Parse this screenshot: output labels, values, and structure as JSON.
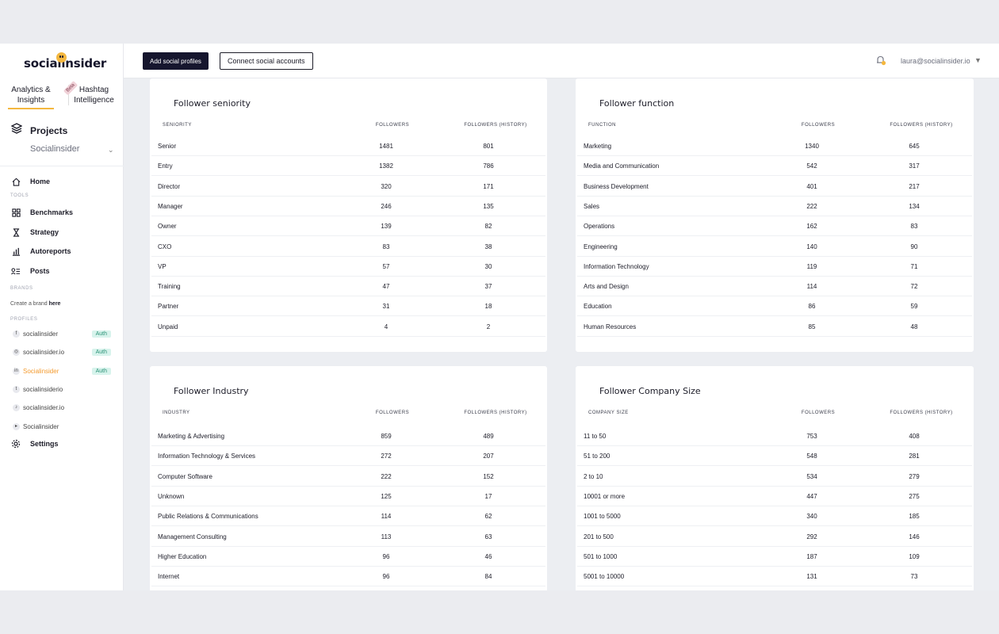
{
  "brand": {
    "name": "socialinsider",
    "accent": "#f4b73f",
    "dark": "#16162e"
  },
  "module_tabs": [
    {
      "label_line1": "Analytics &",
      "label_line2": "Insights"
    },
    {
      "label_line1": "Hashtag",
      "label_line2": "Intelligence"
    }
  ],
  "beta_badge": "Beta",
  "sidebar": {
    "projects_label": "Projects",
    "project_selected": "Socialinsider",
    "home_label": "Home",
    "tools_label": "TOOLS",
    "tools": [
      "Benchmarks",
      "Strategy",
      "Autoreports",
      "Posts"
    ],
    "brands_label": "BRANDS",
    "create_brand_prefix": "Create a brand ",
    "create_brand_link": "here",
    "profiles_label": "PROFILES",
    "profiles": [
      {
        "name": "socialinsider",
        "icon": "facebook-icon",
        "glyph": "f",
        "auth": "Auth"
      },
      {
        "name": "socialinsider.io",
        "icon": "instagram-icon",
        "glyph": "◎",
        "auth": "Auth"
      },
      {
        "name": "Socialinsider",
        "icon": "linkedin-icon",
        "glyph": "in",
        "auth": "Auth"
      },
      {
        "name": "socialinsiderio",
        "icon": "twitter-icon",
        "glyph": "t"
      },
      {
        "name": "socialinsider.io",
        "icon": "tiktok-icon",
        "glyph": "♪"
      },
      {
        "name": "Socialinsider",
        "icon": "youtube-icon",
        "glyph": "▸"
      }
    ],
    "settings_label": "Settings"
  },
  "header": {
    "add_profiles": "Add social profiles",
    "connect_accounts": "Connect social accounts",
    "user_email": "laura@socialinsider.io"
  },
  "cards": {
    "seniority": {
      "title": "Follower seniority",
      "headers": [
        "SENIORITY",
        "FOLLOWERS",
        "FOLLOWERS (HISTORY)"
      ],
      "rows": [
        [
          "Senior",
          "1481",
          "801"
        ],
        [
          "Entry",
          "1382",
          "786"
        ],
        [
          "Director",
          "320",
          "171"
        ],
        [
          "Manager",
          "246",
          "135"
        ],
        [
          "Owner",
          "139",
          "82"
        ],
        [
          "CXO",
          "83",
          "38"
        ],
        [
          "VP",
          "57",
          "30"
        ],
        [
          "Training",
          "47",
          "37"
        ],
        [
          "Partner",
          "31",
          "18"
        ],
        [
          "Unpaid",
          "4",
          "2"
        ]
      ]
    },
    "function": {
      "title": "Follower function",
      "headers": [
        "FUNCTION",
        "FOLLOWERS",
        "FOLLOWERS (HISTORY)"
      ],
      "rows": [
        [
          "Marketing",
          "1340",
          "645"
        ],
        [
          "Media and Communication",
          "542",
          "317"
        ],
        [
          "Business Development",
          "401",
          "217"
        ],
        [
          "Sales",
          "222",
          "134"
        ],
        [
          "Operations",
          "162",
          "83"
        ],
        [
          "Engineering",
          "140",
          "90"
        ],
        [
          "Information Technology",
          "119",
          "71"
        ],
        [
          "Arts and Design",
          "114",
          "72"
        ],
        [
          "Education",
          "86",
          "59"
        ],
        [
          "Human Resources",
          "85",
          "48"
        ]
      ]
    },
    "industry": {
      "title": "Follower Industry",
      "headers": [
        "INDUSTRY",
        "FOLLOWERS",
        "FOLLOWERS (HISTORY)"
      ],
      "rows": [
        [
          "Marketing & Advertising",
          "859",
          "489"
        ],
        [
          "Information Technology & Services",
          "272",
          "207"
        ],
        [
          "Computer Software",
          "222",
          "152"
        ],
        [
          "Unknown",
          "125",
          "17"
        ],
        [
          "Public Relations & Communications",
          "114",
          "62"
        ],
        [
          "Management Consulting",
          "113",
          "63"
        ],
        [
          "Higher Education",
          "96",
          "46"
        ],
        [
          "Internet",
          "96",
          "84"
        ]
      ]
    },
    "company_size": {
      "title": "Follower Company Size",
      "headers": [
        "COMPANY SIZE",
        "FOLLOWERS",
        "FOLLOWERS (HISTORY)"
      ],
      "rows": [
        [
          "11 to 50",
          "753",
          "408"
        ],
        [
          "51 to 200",
          "548",
          "281"
        ],
        [
          "2 to 10",
          "534",
          "279"
        ],
        [
          "10001 or more",
          "447",
          "275"
        ],
        [
          "1001 to 5000",
          "340",
          "185"
        ],
        [
          "201 to 500",
          "292",
          "146"
        ],
        [
          "501 to 1000",
          "187",
          "109"
        ],
        [
          "5001 to 10000",
          "131",
          "73"
        ]
      ]
    }
  }
}
